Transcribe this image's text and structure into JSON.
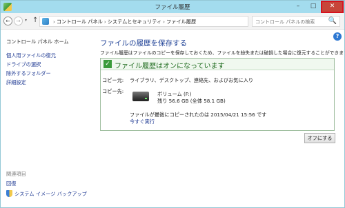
{
  "window": {
    "title": "ファイル履歴",
    "minimize": "–",
    "maximize": "□",
    "close": "✕"
  },
  "nav": {
    "back": "←",
    "forward": "→",
    "recent": "▾",
    "up": "↑"
  },
  "address": {
    "crumbs": [
      "コントロール パネル",
      "システムとセキュリティ",
      "ファイル履歴"
    ],
    "separator": "›",
    "dropdown": "▾",
    "refresh": "⟳"
  },
  "search": {
    "placeholder": "コントロール パネルの検索",
    "icon": "🔍"
  },
  "sidebar": {
    "home": "コントロール パネル ホーム",
    "items": [
      "個人用ファイルの復元",
      "ドライブの選択",
      "除外するフォルダー",
      "詳細設定"
    ],
    "related_heading": "関連項目",
    "related": [
      "回復",
      "システム イメージ バックアップ"
    ]
  },
  "help": {
    "label": "?"
  },
  "main": {
    "title": "ファイルの履歴を保存する",
    "description": "ファイル履歴はファイルのコピーを保存しておくため、ファイルを紛失または破損した場合に復元することができます。",
    "status": {
      "check": "✓",
      "text": "ファイル履歴はオンになっています",
      "source_label": "コピー元:",
      "source_value": "ライブラリ、デスクトップ、連絡先、およびお気に入り",
      "dest_label": "コピー先:",
      "drive_name": "ボリューム (F:)",
      "drive_space": "残り 56.6 GB (全体 58.1 GB)",
      "last_copy": "ファイルが最後にコピーされたのは 2015/04/21 15:56 です",
      "run_now": "今すぐ実行"
    },
    "off_button": "オフにする"
  },
  "colors": {
    "titlebar": "#a3dcee",
    "close_highlight": "#d6121e",
    "link": "#1f3a93",
    "status_green": "#1c6a1c"
  },
  "icons": {
    "app": "file-history-icon",
    "address": "control-panel-icon",
    "drive": "drive-icon",
    "system_image": "shield-icon"
  }
}
